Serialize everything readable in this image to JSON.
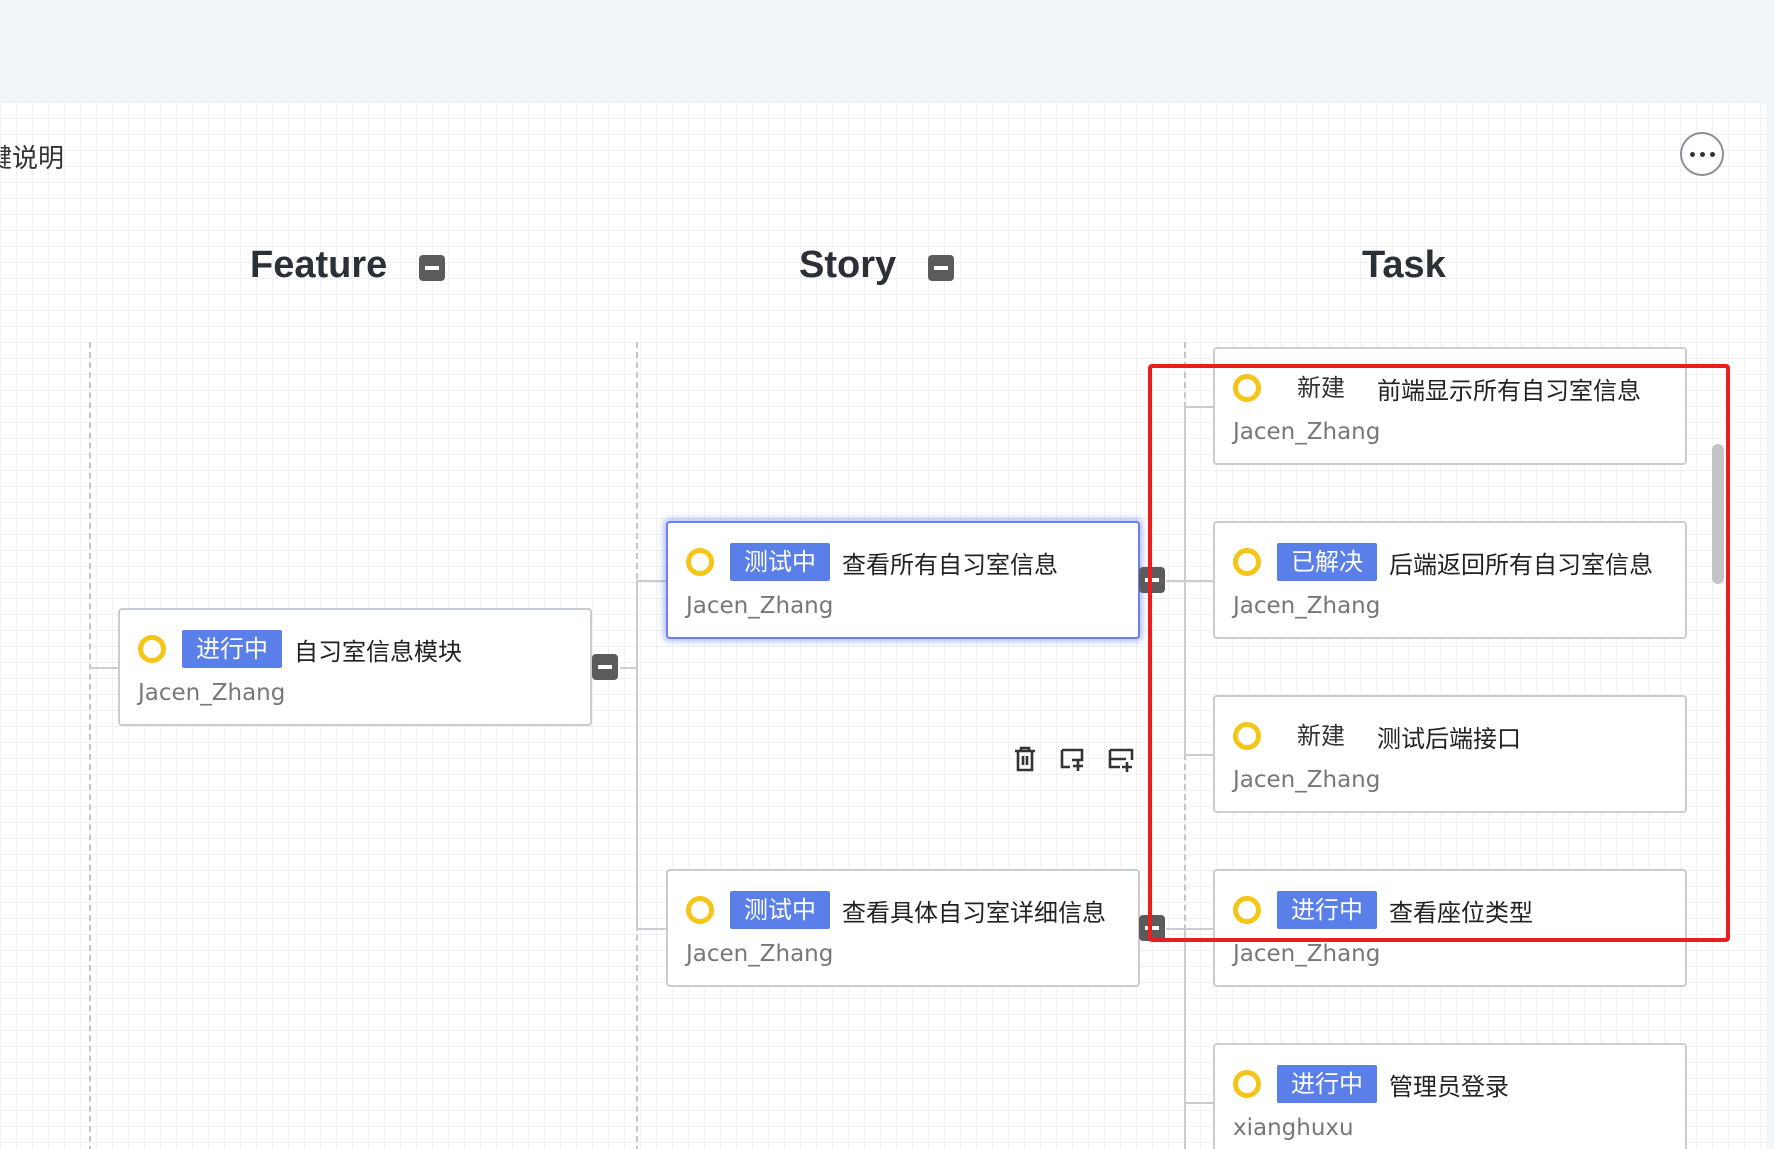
{
  "canvas": {
    "title": "键说明",
    "more_label": "···"
  },
  "columns": [
    {
      "id": "feature",
      "title": "Feature"
    },
    {
      "id": "story",
      "title": "Story"
    },
    {
      "id": "task",
      "title": "Task"
    }
  ],
  "feature": {
    "card1": {
      "status": "进行中",
      "title": "自习室信息模块",
      "assignee": "Jacen_Zhang"
    }
  },
  "story": {
    "card1": {
      "status": "测试中",
      "title": "查看所有自习室信息",
      "assignee": "Jacen_Zhang",
      "selected": true
    },
    "card2": {
      "status": "测试中",
      "title": "查看具体自习室详细信息",
      "assignee": "Jacen_Zhang"
    }
  },
  "task": {
    "card1": {
      "status": "新建",
      "title": "前端显示所有自习室信息",
      "assignee": "Jacen_Zhang"
    },
    "card2": {
      "status": "已解决",
      "title": "后端返回所有自习室信息",
      "assignee": "Jacen_Zhang"
    },
    "card3": {
      "status": "新建",
      "title": "测试后端接口",
      "assignee": "Jacen_Zhang"
    },
    "card4": {
      "status": "进行中",
      "title": "查看座位类型",
      "assignee": "Jacen_Zhang"
    },
    "card5": {
      "status": "进行中",
      "title": "管理员登录",
      "assignee": "xianghuxu"
    }
  },
  "node_toolbar": {
    "icons": [
      "delete-icon",
      "add-child-icon",
      "add-sibling-icon"
    ]
  },
  "colors": {
    "status_badge": "#5b7fe8",
    "status_ring": "#f5c518",
    "highlight": "#e8201d",
    "selected_border": "#6c7ff0"
  }
}
